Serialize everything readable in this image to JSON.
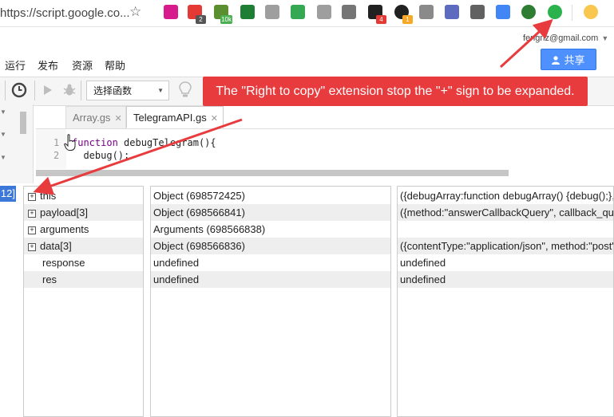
{
  "browser": {
    "url": "https://script.google.co...",
    "extensions": [
      {
        "name": "pink-puzzle-icon",
        "color": "#d81b8c",
        "badge": ""
      },
      {
        "name": "red-adblock-icon",
        "color": "#e53935",
        "badge": "2",
        "badge_color": "#555555"
      },
      {
        "name": "green-10k-icon",
        "color": "#5b8e2f",
        "badge": "10k",
        "badge_color": "#4caf50"
      },
      {
        "name": "v-green-icon",
        "color": "#1e7e34",
        "badge": ""
      },
      {
        "name": "cursor-icon",
        "color": "#9e9e9e",
        "badge": ""
      },
      {
        "name": "drive-arrow-icon",
        "color": "#34a853",
        "badge": ""
      },
      {
        "name": "fb-gray-icon",
        "color": "#9e9e9e",
        "badge": ""
      },
      {
        "name": "camera-icon",
        "color": "#757575",
        "badge": ""
      },
      {
        "name": "black-square-icon",
        "color": "#212121",
        "badge": "4",
        "badge_color": "#e53935"
      },
      {
        "name": "black-circle-icon",
        "color": "#212121",
        "badge": "1",
        "badge_color": "#f9a825"
      },
      {
        "name": "gear-gray-icon",
        "color": "#8a8a8a",
        "badge": ""
      },
      {
        "name": "blue-mark-icon",
        "color": "#5c6bc0",
        "badge": ""
      },
      {
        "name": "c-gray-icon",
        "color": "#616161",
        "badge": ""
      },
      {
        "name": "google-docs-icon",
        "color": "#4285f4",
        "badge": ""
      },
      {
        "name": "globe-icon",
        "color": "#2e7d32",
        "badge": ""
      },
      {
        "name": "right-to-copy-icon",
        "color": "#2bb24c",
        "badge": ""
      },
      {
        "name": "profile-emoji-icon",
        "color": "#f9c74f",
        "badge": ""
      }
    ]
  },
  "account": {
    "email": "fengnz@gmail.com"
  },
  "menu": [
    "运行",
    "发布",
    "资源",
    "帮助"
  ],
  "share_button": {
    "label": "共享",
    "color": "#4d90fe"
  },
  "toolbar": {
    "function_select": "选择函数"
  },
  "annotation": {
    "text": "The \"Right to copy\" extension stop the \"+\" sign to be expanded.",
    "color": "#e83b3d"
  },
  "tabs": [
    {
      "label": "Array.gs",
      "active": false
    },
    {
      "label": "TelegramAPI.gs",
      "active": true
    }
  ],
  "code": {
    "lines": [
      {
        "number": "1",
        "text": "function debugTelegram(){"
      },
      {
        "number": "2",
        "text": "  debug();"
      }
    ]
  },
  "debugger": {
    "line_indicator": "12]",
    "variables": [
      {
        "name": "this",
        "expandable": true,
        "type": "Object (698572425)",
        "value": "({debugArray:function debugArray() {debug();},"
      },
      {
        "name": "payload[3]",
        "expandable": true,
        "type": "Object (698566841)",
        "value": "({method:\"answerCallbackQuery\", callback_qu"
      },
      {
        "name": "arguments",
        "expandable": true,
        "type": "Arguments (698566838)",
        "value": ""
      },
      {
        "name": "data[3]",
        "expandable": true,
        "type": "Object (698566836)",
        "value": "({contentType:\"application/json\", method:\"post\""
      },
      {
        "name": "response",
        "expandable": false,
        "type": "undefined",
        "value": "undefined"
      },
      {
        "name": "res",
        "expandable": false,
        "type": "undefined",
        "value": "undefined"
      }
    ]
  }
}
